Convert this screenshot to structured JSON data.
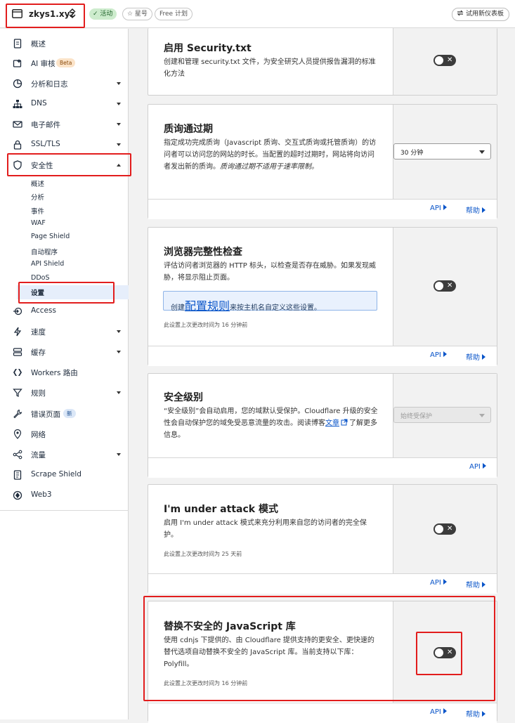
{
  "header": {
    "domain": "zkys1.xyz",
    "status_badge": "✓ 活动",
    "star_label": "☆ 星号",
    "plan_label": "Free 计划",
    "try_new_dashboard": "试用新仪表板"
  },
  "sidebar": {
    "items": [
      {
        "label": "概述",
        "icon": "document-icon"
      },
      {
        "label": "AI 审核",
        "icon": "ai-audit-icon",
        "badge": "Beta"
      },
      {
        "label": "分析和日志",
        "icon": "chart-pie-icon"
      },
      {
        "label": "DNS",
        "icon": "network-icon"
      },
      {
        "label": "电子邮件",
        "icon": "mail-icon"
      },
      {
        "label": "SSL/TLS",
        "icon": "lock-icon"
      },
      {
        "label": "安全性",
        "icon": "shield-icon"
      },
      {
        "label": "Access",
        "icon": "access-icon"
      },
      {
        "label": "速度",
        "icon": "lightning-icon"
      },
      {
        "label": "缓存",
        "icon": "storage-icon"
      },
      {
        "label": "Workers 路由",
        "icon": "workers-icon"
      },
      {
        "label": "规则",
        "icon": "funnel-icon"
      },
      {
        "label": "错误页面",
        "icon": "wrench-icon",
        "badge": "新"
      },
      {
        "label": "网络",
        "icon": "location-icon"
      },
      {
        "label": "流量",
        "icon": "traffic-icon"
      },
      {
        "label": "Scrape Shield",
        "icon": "scrape-icon"
      },
      {
        "label": "Web3",
        "icon": "web3-icon"
      }
    ],
    "security_sub": [
      "概述",
      "分析",
      "事件",
      "WAF",
      "Page Shield",
      "自动程序",
      "API Shield",
      "DDoS",
      "设置"
    ]
  },
  "cards": {
    "security_txt": {
      "title": "启用 Security.txt",
      "desc": "创建和管理 security.txt 文件，为安全研究人员提供报告漏洞的标准化方法"
    },
    "challenge": {
      "title": "质询通过期",
      "desc_main": "指定成功完成质询（Javascript 质询、交互式质询或托管质询）的访问者可以访问您的网站的时长。当配置的超时过期时，网站将向访问者发出新的质询。",
      "desc_italic": "质询通过期不适用于速率限制。",
      "select_value": "30 分钟",
      "api": "API",
      "help": "帮助"
    },
    "browser_check": {
      "title": "浏览器完整性检查",
      "desc": "评估访问者浏览器的 HTTP 标头，以检查是否存在威胁。如果发现威胁，将显示阻止页面。",
      "info_prefix": "创建",
      "info_link": "配置规则",
      "info_suffix": "来按主机名自定义这些设置。",
      "meta": "此设置上次更改时间为 16 分钟前",
      "api": "API",
      "help": "帮助"
    },
    "security_level": {
      "title": "安全级别",
      "desc_main": "“安全级别”会自动启用，您的域默认受保护。Cloudflare 升级的安全性会自动保护您的域免受恶意流量的攻击。阅读博客",
      "desc_link": "文章",
      "desc_suffix": "了解更多信息。",
      "select_value": "始终受保护",
      "api": "API"
    },
    "under_attack": {
      "title": "I'm under attack 模式",
      "desc": "启用 I'm under attack 模式来充分利用来自您的访问者的完全保护。",
      "meta": "此设置上次更改时间为 25 天前",
      "api": "API",
      "help": "帮助"
    },
    "replace_js": {
      "title": "替换不安全的 JavaScript 库",
      "desc": "使用 cdnjs 下提供的、由 Cloudflare 提供支持的更安全、更快速的替代选项自动替换不安全的 JavaScript 库。当前支持以下库：Polyfill。",
      "meta": "此设置上次更改时间为 16 分钟前",
      "api": "API",
      "help": "帮助"
    }
  },
  "toggle_symbol": "✕",
  "colors": {
    "highlight_red": "#e21d1d",
    "link_blue": "#0a55c9",
    "active_green": "#cdeccd",
    "toggle_dark": "#3c3c3c"
  }
}
